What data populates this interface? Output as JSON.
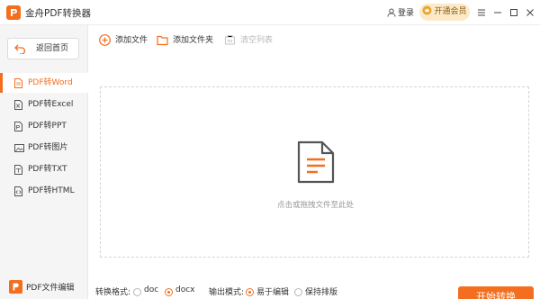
{
  "app": {
    "title": "金舟PDF转换器",
    "login_label": "登录",
    "vip_label": "开通会员",
    "accent_color": "#f36e1e"
  },
  "sidebar": {
    "back_label": "返回首页",
    "items": [
      {
        "label": "PDF转Word",
        "icon": "word-doc-icon",
        "active": true
      },
      {
        "label": "PDF转Excel",
        "icon": "excel-doc-icon",
        "active": false
      },
      {
        "label": "PDF转PPT",
        "icon": "ppt-doc-icon",
        "active": false
      },
      {
        "label": "PDF转图片",
        "icon": "image-doc-icon",
        "active": false
      },
      {
        "label": "PDF转TXT",
        "icon": "txt-doc-icon",
        "active": false
      },
      {
        "label": "PDF转HTML",
        "icon": "html-doc-icon",
        "active": false
      }
    ],
    "pdf_edit_label": "PDF文件编辑"
  },
  "toolbar": {
    "add_file_label": "添加文件",
    "add_folder_label": "添加文件夹",
    "clear_list_label": "清空列表"
  },
  "dropzone": {
    "hint": "点击或拖拽文件至此处"
  },
  "options": {
    "format_label": "转换格式:",
    "format_options": [
      "doc",
      "docx"
    ],
    "format_selected": "docx",
    "mode_label": "输出模式:",
    "mode_options": [
      "易于编辑",
      "保持排版"
    ],
    "mode_selected": "易于编辑"
  },
  "start_button_label": "开始转换"
}
